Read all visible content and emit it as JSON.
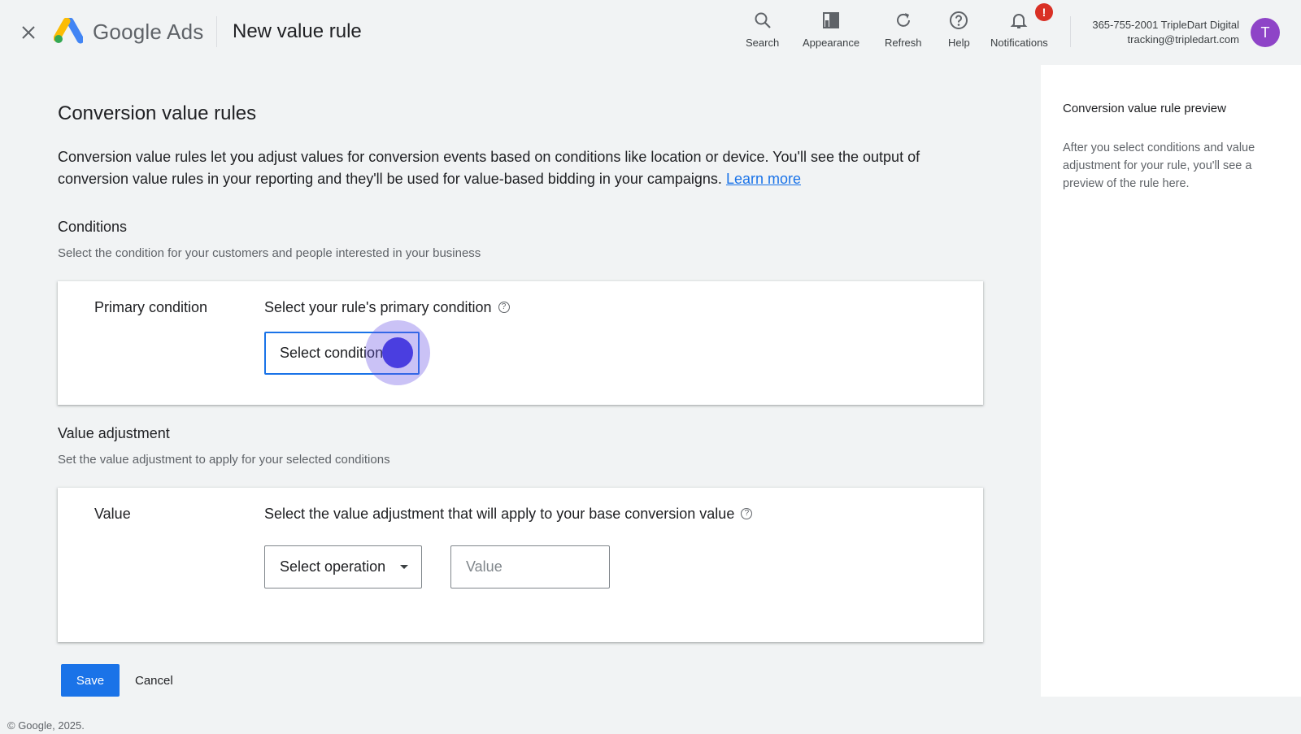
{
  "app": {
    "brand": "Google Ads",
    "page_title": "New value rule"
  },
  "toolbar": {
    "search_label": "Search",
    "appearance_label": "Appearance",
    "refresh_label": "Refresh",
    "help_label": "Help",
    "notifications_label": "Notifications",
    "notifications_badge": "!"
  },
  "account": {
    "line1": "365-755-2001 TripleDart Digital",
    "line2": "tracking@tripledart.com",
    "avatar_letter": "T"
  },
  "main": {
    "heading": "Conversion value rules",
    "intro_text": "Conversion value rules let you adjust values for conversion events based on conditions like location or device. You'll see the output of conversion value rules in your reporting and they'll be used for value-based bidding in your campaigns.",
    "learn_more": "Learn more"
  },
  "conditions": {
    "title": "Conditions",
    "subtitle": "Select the condition for your customers and people interested in your business",
    "label": "Primary condition",
    "question": "Select your rule's primary condition",
    "select_text": "Select condition"
  },
  "value_adjustment": {
    "title": "Value adjustment",
    "subtitle": "Set the value adjustment to apply for your selected conditions",
    "label": "Value",
    "question": "Select the value adjustment that will apply to your base conversion value",
    "operation_text": "Select operation",
    "value_placeholder": "Value"
  },
  "actions": {
    "save_label": "Save",
    "cancel_label": "Cancel"
  },
  "footer": {
    "copyright": "© Google, 2025."
  },
  "preview": {
    "title": "Conversion value rule preview",
    "body": "After you select conditions and value adjustment for your rule, you'll see a preview of the rule here."
  },
  "icons": {
    "close": "close-icon",
    "search": "search-icon",
    "appearance": "appearance-icon",
    "refresh": "refresh-icon",
    "help": "help-icon",
    "notifications": "bell-icon"
  },
  "colors": {
    "accent": "#1a73e8",
    "badge": "#d93025",
    "avatar": "#8e44c7"
  }
}
